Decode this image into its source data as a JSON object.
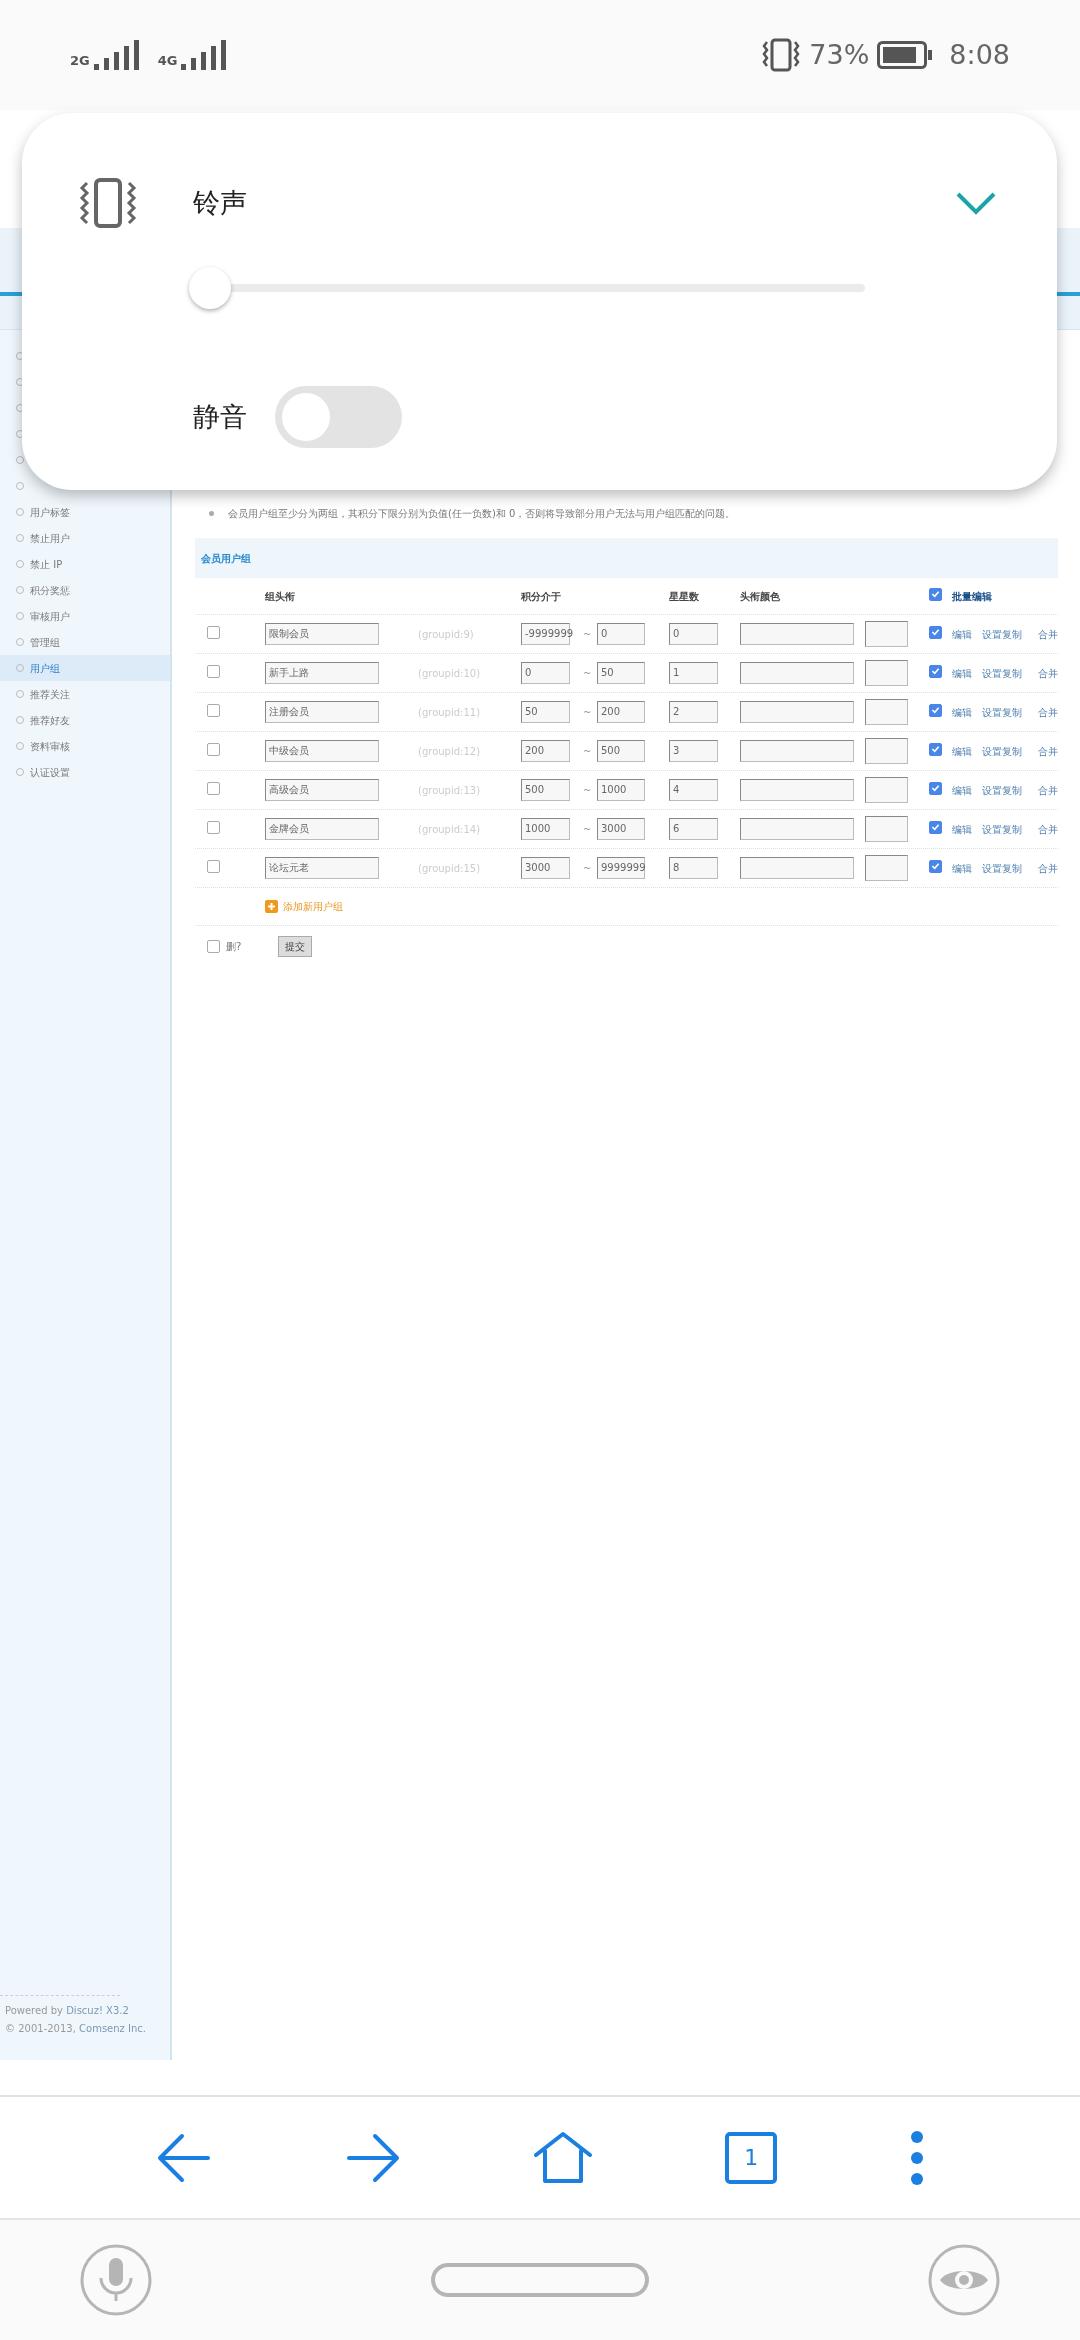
{
  "status_bar": {
    "signals": [
      "2G",
      "4G"
    ],
    "battery": "73%",
    "time": "8:08"
  },
  "volume_panel": {
    "title": "铃声",
    "slider": {
      "level": 0
    },
    "mute": {
      "label": "静音",
      "on": false
    }
  },
  "sidebar": {
    "items": [
      {
        "label": "用户标签",
        "selected": false
      },
      {
        "label": "禁止用户",
        "selected": false
      },
      {
        "label": "禁止 IP",
        "selected": false
      },
      {
        "label": "积分奖惩",
        "selected": false
      },
      {
        "label": "审核用户",
        "selected": false
      },
      {
        "label": "管理组",
        "selected": false
      },
      {
        "label": "用户组",
        "selected": true
      },
      {
        "label": "推荐关注",
        "selected": false
      },
      {
        "label": "推荐好友",
        "selected": false
      },
      {
        "label": "资料审核",
        "selected": false
      },
      {
        "label": "认证设置",
        "selected": false
      }
    ],
    "footer": [
      {
        "prefix": "Powered by",
        "link": "Discuz! X3.2"
      },
      {
        "prefix": "© 2001-2013,",
        "link": "Comsenz Inc."
      }
    ]
  },
  "notice": "会员用户组至少分为两组，其积分下限分别为负值(任一负数)和 0，否则将导致部分用户无法与用户组匹配的问题。",
  "table": {
    "title": "会员用户组",
    "columns": [
      "组头衔",
      "积分介于",
      "星星数",
      "头衔颜色"
    ],
    "batch_edit": {
      "label": "批量编辑",
      "checked": true
    },
    "rows": [
      {
        "checked": false,
        "title": "限制会员",
        "groupid": "(groupid:9)",
        "min": "-9999999",
        "separator": "~",
        "max": "0",
        "stars_count": "0",
        "edit_checked": true,
        "actions": [
          "编辑",
          "设置复制",
          "合并"
        ]
      },
      {
        "checked": false,
        "title": "新手上路",
        "groupid": "(groupid:10)",
        "min": "0",
        "separator": "~",
        "max": "50",
        "stars_count": "1",
        "edit_checked": true,
        "actions": [
          "编辑",
          "设置复制",
          "合并"
        ]
      },
      {
        "checked": false,
        "title": "注册会员",
        "groupid": "(groupid:11)",
        "min": "50",
        "separator": "~",
        "max": "200",
        "stars_count": "2",
        "edit_checked": true,
        "actions": [
          "编辑",
          "设置复制",
          "合并"
        ]
      },
      {
        "checked": false,
        "title": "中级会员",
        "groupid": "(groupid:12)",
        "min": "200",
        "separator": "~",
        "max": "500",
        "stars_count": "3",
        "edit_checked": true,
        "actions": [
          "编辑",
          "设置复制",
          "合并"
        ]
      },
      {
        "checked": false,
        "title": "高级会员",
        "groupid": "(groupid:13)",
        "min": "500",
        "separator": "~",
        "max": "1000",
        "stars_count": "4",
        "edit_checked": true,
        "actions": [
          "编辑",
          "设置复制",
          "合并"
        ]
      },
      {
        "checked": false,
        "title": "金牌会员",
        "groupid": "(groupid:14)",
        "min": "1000",
        "separator": "~",
        "max": "3000",
        "stars_count": "6",
        "edit_checked": true,
        "actions": [
          "编辑",
          "设置复制",
          "合并"
        ]
      },
      {
        "checked": false,
        "title": "论坛元老",
        "groupid": "(groupid:15)",
        "min": "3000",
        "separator": "~",
        "max": "9999999",
        "stars_count": "8",
        "edit_checked": true,
        "actions": [
          "编辑",
          "设置复制",
          "合并"
        ]
      }
    ],
    "add_label": "添加新用户组",
    "delete": {
      "label": "删?",
      "checked": false
    },
    "submit": "提交"
  },
  "browser_bar": {
    "tab_count": "1"
  }
}
